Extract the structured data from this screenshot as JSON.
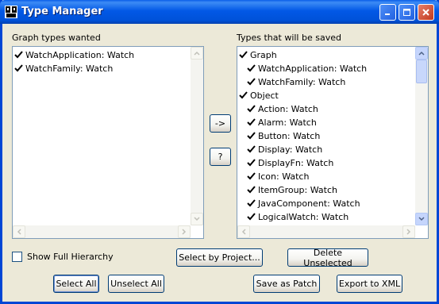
{
  "window": {
    "title": "Type Manager",
    "icon": "java-cup-icon"
  },
  "left": {
    "label": "Graph types wanted",
    "items": [
      {
        "text": "WatchApplication: Watch",
        "checked": true
      },
      {
        "text": "WatchFamily: Watch",
        "checked": true
      }
    ]
  },
  "right": {
    "label": "Types that will be saved",
    "items": [
      {
        "text": "Graph",
        "checked": true,
        "indent": 0
      },
      {
        "text": "WatchApplication: Watch",
        "checked": true,
        "indent": 1
      },
      {
        "text": "WatchFamily: Watch",
        "checked": true,
        "indent": 1
      },
      {
        "text": "Object",
        "checked": true,
        "indent": 0
      },
      {
        "text": "Action: Watch",
        "checked": true,
        "indent": 1
      },
      {
        "text": "Alarm: Watch",
        "checked": true,
        "indent": 1
      },
      {
        "text": "Button: Watch",
        "checked": true,
        "indent": 1
      },
      {
        "text": "Display: Watch",
        "checked": true,
        "indent": 1
      },
      {
        "text": "DisplayFn: Watch",
        "checked": true,
        "indent": 1
      },
      {
        "text": "Icon: Watch",
        "checked": true,
        "indent": 1
      },
      {
        "text": "ItemGroup: Watch",
        "checked": true,
        "indent": 1
      },
      {
        "text": "JavaComponent: Watch",
        "checked": true,
        "indent": 1
      },
      {
        "text": "LogicalWatch: Watch",
        "checked": true,
        "indent": 1
      }
    ]
  },
  "middle": {
    "move_label": "->",
    "help_label": "?"
  },
  "options": {
    "show_full_hierarchy_label": "Show Full Hierarchy",
    "show_full_hierarchy_checked": false
  },
  "buttons": {
    "select_by_project": "Select by Project...",
    "delete_unselected": "Delete Unselected",
    "select_all": "Select All",
    "unselect_all": "Unselect All",
    "save_as_patch": "Save as Patch",
    "export_to_xml": "Export to XML"
  }
}
